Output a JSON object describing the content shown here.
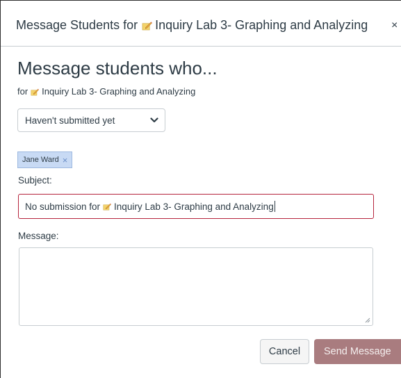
{
  "dialog": {
    "title_prefix": "Message Students for",
    "title_assignment": "Inquiry Lab 3- Graphing and Analyzing",
    "close_label": "×"
  },
  "form": {
    "heading": "Message students who...",
    "for_prefix": "for",
    "for_assignment": "Inquiry Lab 3- Graphing and Analyzing",
    "criteria_selected": "Haven't submitted yet",
    "recipients": [
      {
        "name": "Jane Ward",
        "remove": "×"
      }
    ],
    "subject_label": "Subject:",
    "subject_prefix": "No submission for",
    "subject_assignment": "Inquiry Lab 3- Graphing and Analyzing",
    "message_label": "Message:",
    "message_value": ""
  },
  "buttons": {
    "cancel": "Cancel",
    "send": "Send Message"
  },
  "icons": {
    "assignment": "pencil-note-icon",
    "select": "chevron-down-icon",
    "close": "close-icon",
    "remove_recipient": "close-icon",
    "resize": "resize-grip-icon"
  },
  "colors": {
    "send_button": "#a97c7f",
    "subject_border": "#b5233c",
    "chip_bg": "#c8daf4"
  }
}
